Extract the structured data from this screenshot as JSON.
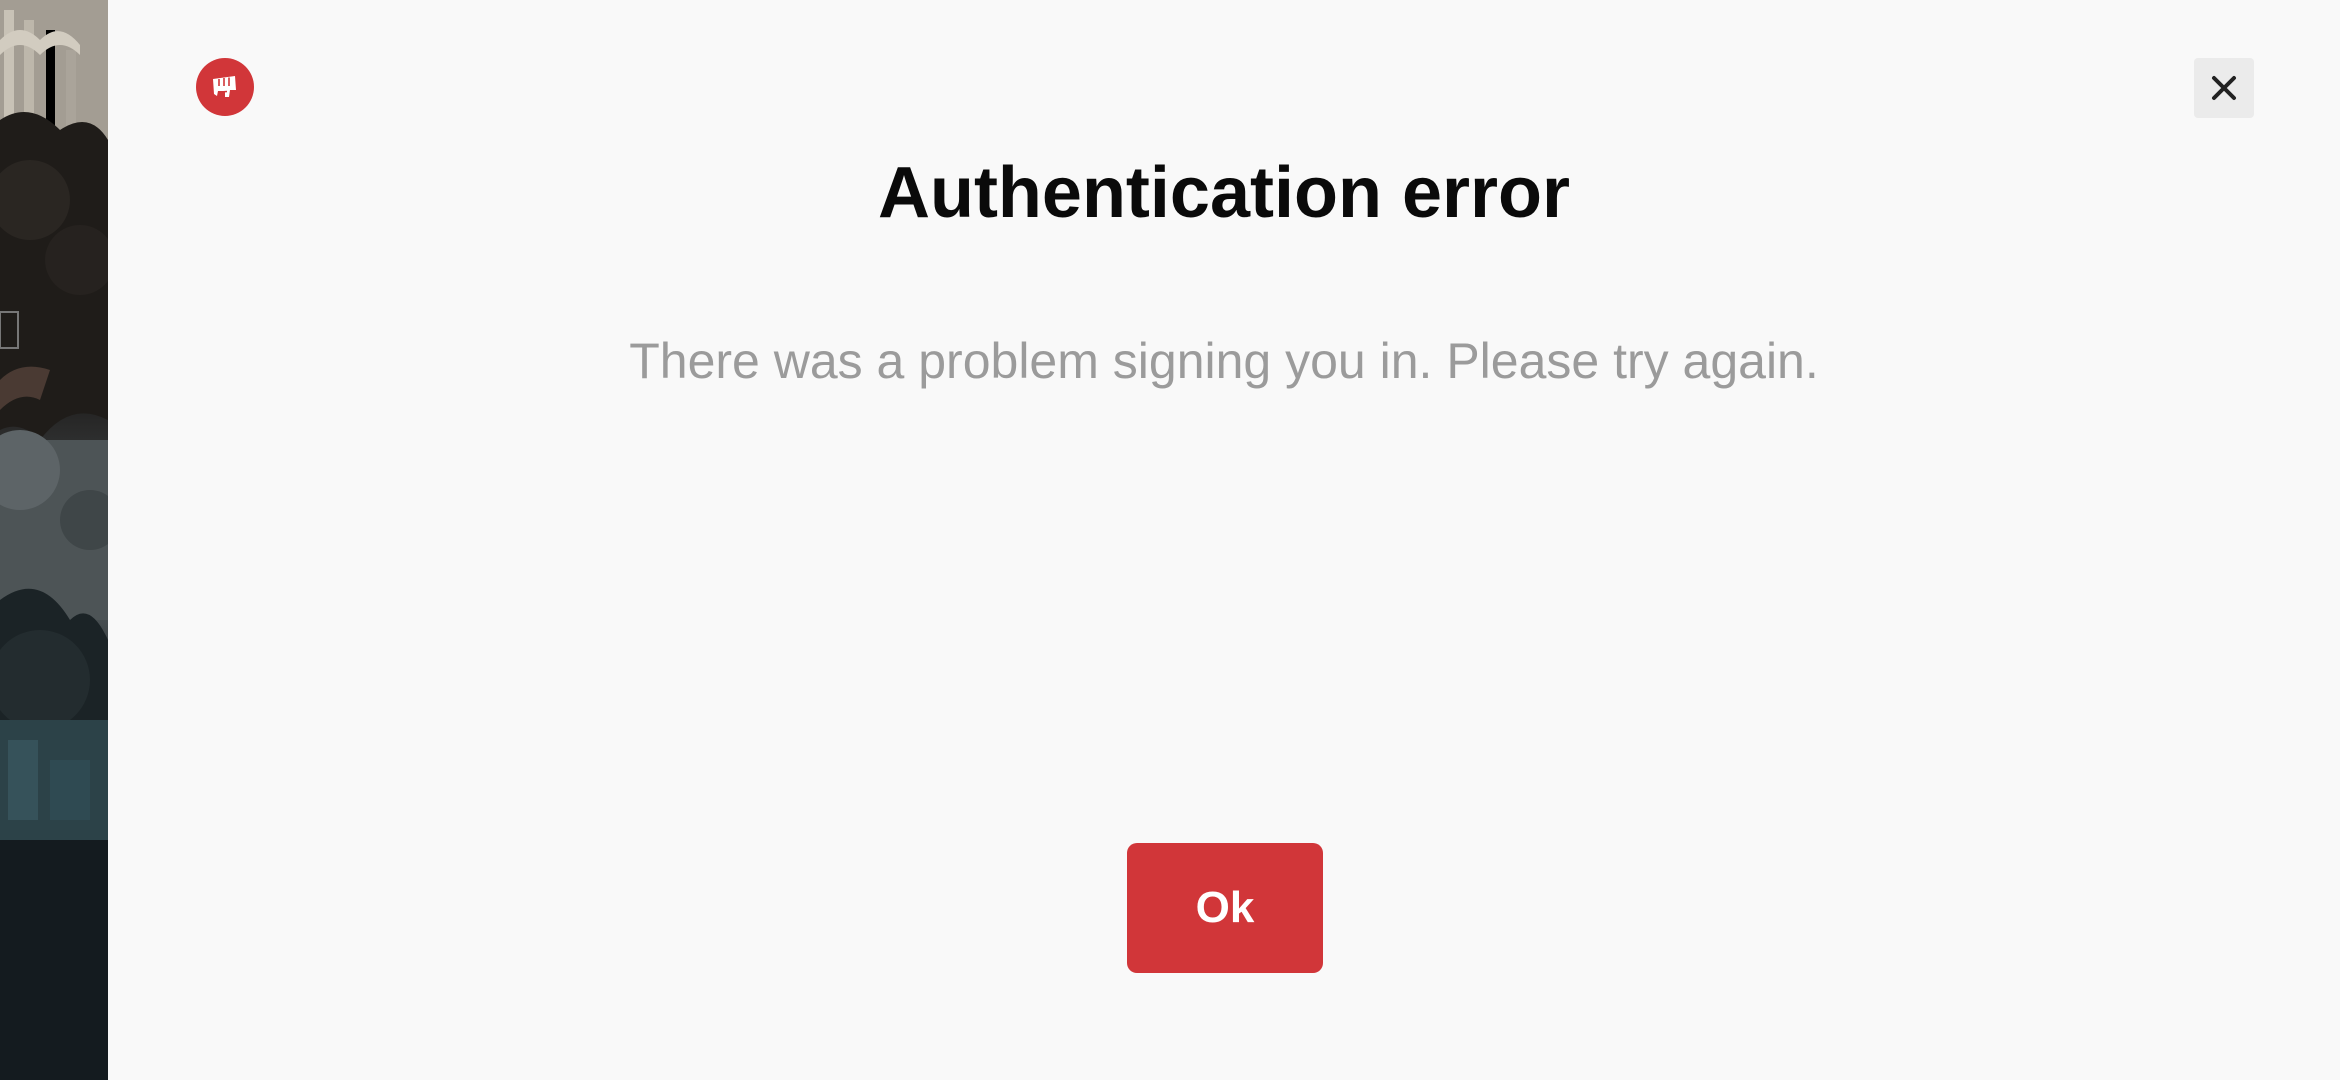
{
  "dialog": {
    "title": "Authentication error",
    "message": "There was a problem signing you in. Please try again.",
    "ok_label": "Ok",
    "close_glyph": "✕"
  },
  "icons": {
    "logo": "riot-fist-logo-icon",
    "close": "close-icon"
  },
  "colors": {
    "accent": "#d13639",
    "panel_background": "#f9f9f9",
    "title_text": "#0a0a0a",
    "message_text": "#9b9b9b",
    "close_button_background": "#ebebeb"
  }
}
